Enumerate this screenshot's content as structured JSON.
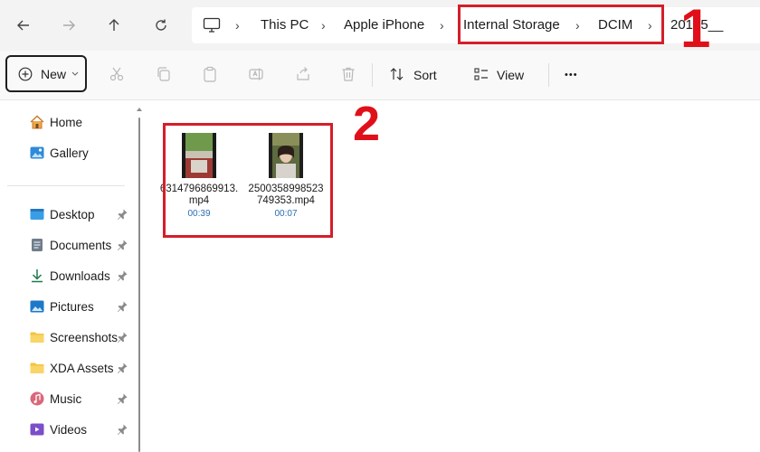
{
  "address_bar": {
    "crumbs": [
      "This PC",
      "Apple iPhone",
      "Internal Storage",
      "DCIM",
      "20​105__"
    ]
  },
  "toolbar": {
    "new_label": "New",
    "sort_label": "Sort",
    "view_label": "View",
    "more_label": "•••"
  },
  "sidebar": {
    "top_items": [
      {
        "label": "Home",
        "icon": "home-icon"
      },
      {
        "label": "Gallery",
        "icon": "gallery-icon"
      }
    ],
    "quick_access": [
      {
        "label": "Desktop",
        "icon": "desktop-folder-icon"
      },
      {
        "label": "Documents",
        "icon": "documents-folder-icon"
      },
      {
        "label": "Downloads",
        "icon": "download-icon"
      },
      {
        "label": "Pictures",
        "icon": "pictures-folder-icon"
      },
      {
        "label": "Screenshots",
        "icon": "folder-icon"
      },
      {
        "label": "XDA Assets",
        "icon": "folder-icon"
      },
      {
        "label": "Music",
        "icon": "music-icon"
      },
      {
        "label": "Videos",
        "icon": "videos-icon"
      }
    ]
  },
  "files": [
    {
      "name_line1": "6314796869913.",
      "name_line2": "mp4",
      "duration": "00:39"
    },
    {
      "name_line1": "2500358998523",
      "name_line2": "749353.mp4",
      "duration": "00:07"
    }
  ],
  "annotations": {
    "label_1": "1",
    "label_2": "2",
    "color": "#e0101a"
  }
}
